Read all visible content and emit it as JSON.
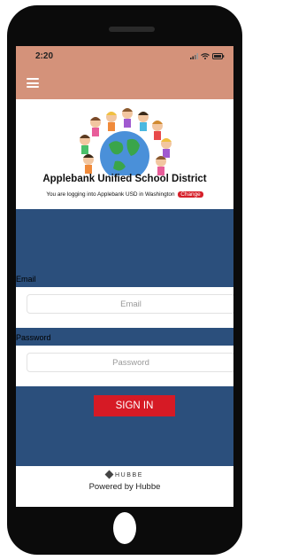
{
  "status_bar": {
    "time": "2:20",
    "background": "#d4927a"
  },
  "header": {
    "menu_icon": "hamburger-menu-icon"
  },
  "district": {
    "name": "Applebank Unified School District",
    "login_notice": "You are logging into Applebank USD in Washington",
    "change_label": "Change"
  },
  "form": {
    "email_label": "Email",
    "email_placeholder": "Email",
    "password_label": "Password",
    "password_placeholder": "Password",
    "signin_label": "SIGN IN"
  },
  "footer": {
    "brand": "HUBBE",
    "powered_by": "Powered by Hubbe"
  },
  "colors": {
    "accent_red": "#d61a25",
    "panel_blue": "#2b4f7c",
    "header_salmon": "#d4927a"
  }
}
